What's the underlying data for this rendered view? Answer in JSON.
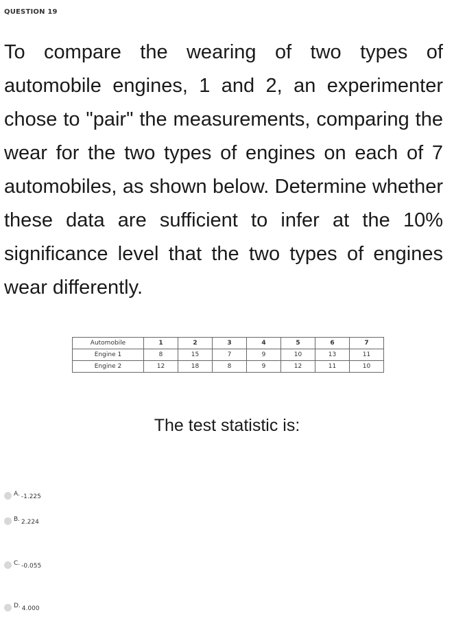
{
  "question": {
    "number_label": "QUESTION 19",
    "prompt": "To compare the wearing of two types of automobile engines, 1 and 2, an experimenter chose to \"pair\" the measurements, comparing the wear for the two types of engines on each of 7 automobiles, as shown below. Determine whether these data are sufficient to infer at the 10% significance level that the two types of engines wear differently.",
    "stat_prompt": "The test statistic is:"
  },
  "table": {
    "header_label": "Automobile",
    "columns": [
      "1",
      "2",
      "3",
      "4",
      "5",
      "6",
      "7"
    ],
    "rows": [
      {
        "label": "Engine 1",
        "values": [
          "8",
          "15",
          "7",
          "9",
          "10",
          "13",
          "11"
        ]
      },
      {
        "label": "Engine 2",
        "values": [
          "12",
          "18",
          "8",
          "9",
          "12",
          "11",
          "10"
        ]
      }
    ]
  },
  "options": [
    {
      "letter": "A.",
      "value": "-1.225"
    },
    {
      "letter": "B.",
      "value": "2.224"
    },
    {
      "letter": "C.",
      "value": "-0.055"
    },
    {
      "letter": "D.",
      "value": "4.000"
    }
  ]
}
